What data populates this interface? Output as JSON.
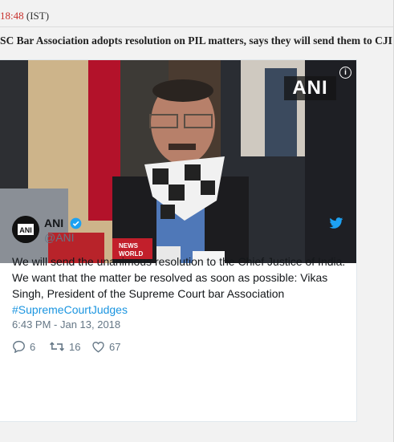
{
  "top": {
    "time": "18:48",
    "zone": "(IST)"
  },
  "headline": "SC Bar Association adopts resolution on PIL matters, says they will send them to CJI M",
  "tweet": {
    "image_watermark": "ANI",
    "name": "ANI",
    "handle": "@ANI",
    "text": "We will send the unanimous resolution to the Chief Justice of India. We want that the matter be resolved as soon as possible: Vikas Singh, President of the Supreme Court bar Association",
    "hashtag": "#SupremeCourtJudges",
    "date": "6:43 PM - Jan 13, 2018",
    "replies": "6",
    "retweets": "16",
    "likes": "67",
    "mic_label": "NEWS WORLD"
  },
  "colors": {
    "time": "#c8302c",
    "link": "#1b95e0",
    "muted": "#657786",
    "verified": "#1da1f2"
  }
}
